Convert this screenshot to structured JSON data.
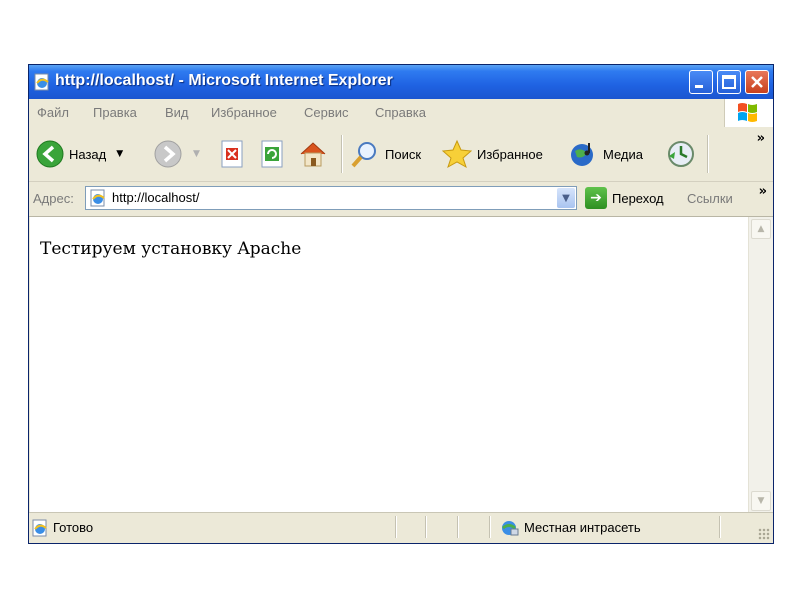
{
  "window": {
    "title": "http://localhost/ - Microsoft Internet Explorer"
  },
  "menu": {
    "items": [
      "Файл",
      "Правка",
      "Вид",
      "Избранное",
      "Сервис",
      "Справка"
    ]
  },
  "toolbar": {
    "back_label": "Назад",
    "search_label": "Поиск",
    "favorites_label": "Избранное",
    "media_label": "Медиа",
    "more_label": "»"
  },
  "address": {
    "label": "Адрес:",
    "value": "http://localhost/",
    "go_label": "Переход",
    "links_label": "Ссылки",
    "links_more": "»"
  },
  "page": {
    "text": "Тестируем установку Apache"
  },
  "status": {
    "text": "Готово",
    "zone": "Местная интрасеть"
  },
  "colors": {
    "titlebar": "#1f62e2",
    "chrome": "#ece9d8",
    "content": "#ffffff"
  }
}
